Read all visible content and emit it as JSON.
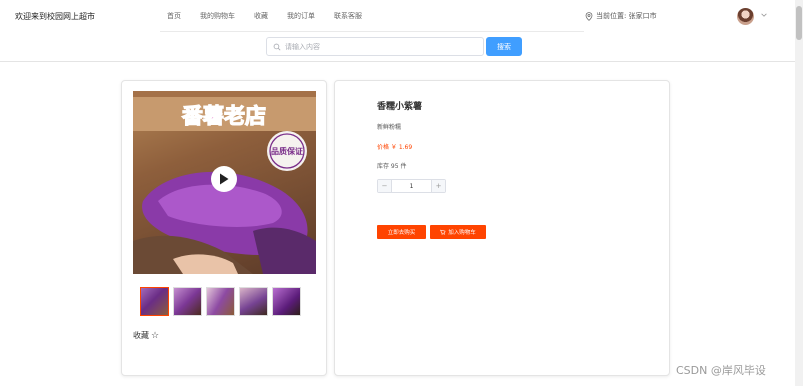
{
  "header": {
    "welcome": "欢迎来到校园网上超市",
    "nav": [
      "首页",
      "我的购物车",
      "收藏",
      "我的订单",
      "联系客服"
    ],
    "location": "当前位置: 张家口市"
  },
  "search": {
    "placeholder": "请输入内容",
    "value": "",
    "button_label": "搜索"
  },
  "gallery": {
    "banner_text": "番薯老店",
    "seal_text": "品质保证",
    "thumb_count": 5,
    "selected_thumb": 1
  },
  "favorite": {
    "label": "收藏",
    "star": "☆"
  },
  "product": {
    "name": "香糯小紫薯",
    "subtitle": "新鲜粉糯",
    "price": "价格 ￥ 1.69",
    "stock": "库存 95 件",
    "quantity": "1",
    "minus": "−",
    "plus": "+",
    "buy_now_label": "立即去购买",
    "add_cart_label": "加入购物车"
  },
  "watermark": "CSDN @岸风毕设",
  "colors": {
    "accent": "#ff4400",
    "search_button": "#409eff"
  }
}
